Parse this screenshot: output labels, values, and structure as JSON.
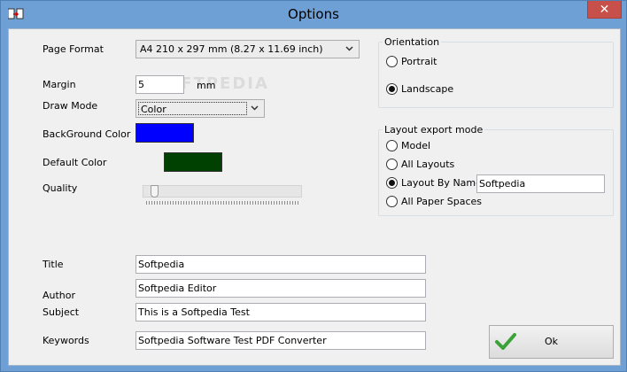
{
  "window": {
    "title": "Options",
    "close_glyph": "✕"
  },
  "form": {
    "page_format_label": "Page Format",
    "page_format_value": "A4 210 x 297 mm (8.27 x 11.69 inch)",
    "margin_label": "Margin",
    "margin_value": "5",
    "margin_unit": "mm",
    "draw_mode_label": "Draw Mode",
    "draw_mode_value": "Color",
    "background_color_label": "BackGround Color",
    "background_color": "#0000ff",
    "default_color_label": "Default Color",
    "default_color": "#004000",
    "quality_label": "Quality",
    "quality_level": 0.05,
    "title_label": "Title",
    "title_value": "Softpedia",
    "author_label": "Author",
    "author_value": "Softpedia Editor",
    "subject_label": "Subject",
    "subject_value": "This is a Softpedia Test",
    "keywords_label": "Keywords",
    "keywords_value": "Softpedia Software Test PDF Converter"
  },
  "orientation": {
    "group_title": "Orientation",
    "options": [
      {
        "label": "Portrait",
        "selected": false
      },
      {
        "label": "Landscape",
        "selected": true
      }
    ]
  },
  "layout_export": {
    "group_title": "Layout export mode",
    "options": [
      {
        "label": "Model",
        "selected": false
      },
      {
        "label": "All Layouts",
        "selected": false
      },
      {
        "label": "Layout By Name",
        "selected": true
      },
      {
        "label": "All Paper Spaces",
        "selected": false
      }
    ],
    "layout_name_value": "Softpedia"
  },
  "ok_button": {
    "label": "Ok",
    "icon": "checkmark-icon",
    "accent": "#3aa236"
  },
  "watermark": "SOFTPEDIA"
}
